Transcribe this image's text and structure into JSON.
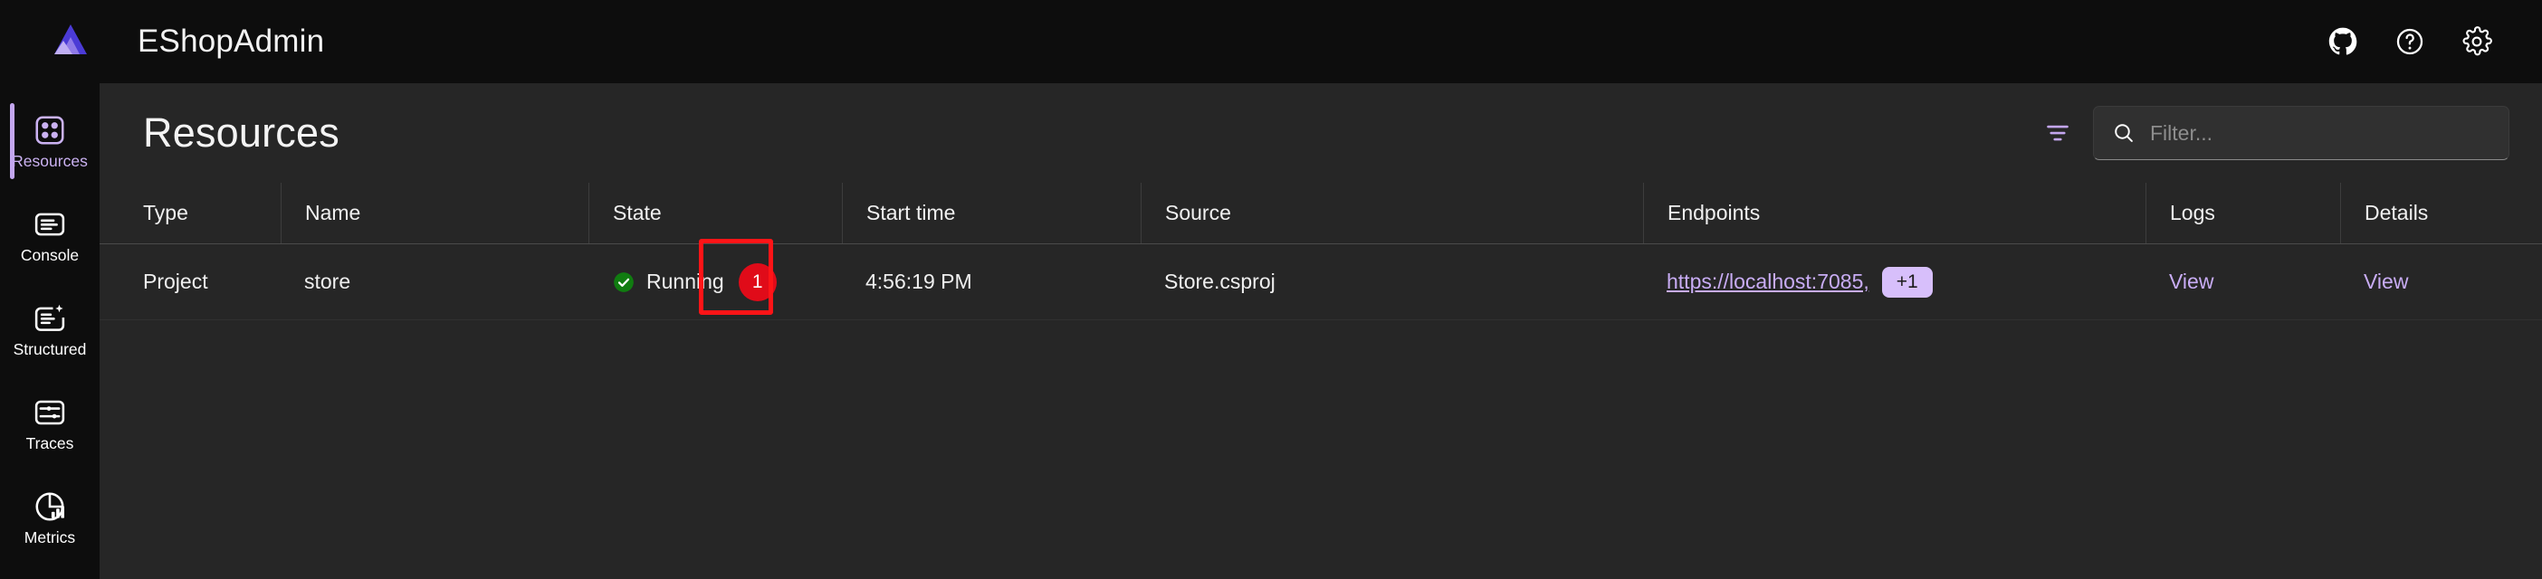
{
  "header": {
    "logo_name": "aspire-logo",
    "title": "EShopAdmin",
    "actions": [
      {
        "name": "github-icon",
        "label": "GitHub"
      },
      {
        "name": "help-icon",
        "label": "Help"
      },
      {
        "name": "settings-gear-icon",
        "label": "Settings"
      }
    ]
  },
  "sidebar": {
    "items": [
      {
        "label": "Resources",
        "icon": "resources-icon",
        "active": true
      },
      {
        "label": "Console",
        "icon": "console-icon",
        "active": false
      },
      {
        "label": "Structured",
        "icon": "structured-icon",
        "active": false
      },
      {
        "label": "Traces",
        "icon": "traces-icon",
        "active": false
      },
      {
        "label": "Metrics",
        "icon": "metrics-icon",
        "active": false
      }
    ]
  },
  "main": {
    "page_title": "Resources",
    "filter_toggle_icon": "filter-icon",
    "search": {
      "icon": "search-icon",
      "placeholder": "Filter...",
      "value": ""
    },
    "table": {
      "columns": [
        "Type",
        "Name",
        "State",
        "Start time",
        "Source",
        "Endpoints",
        "Logs",
        "Details"
      ],
      "rows": [
        {
          "type": "Project",
          "name": "store",
          "state": {
            "icon": "running-check-icon",
            "text": "Running",
            "badge_count": "1",
            "badge_color": "#e00b19",
            "annotated": true
          },
          "start_time": "4:56:19 PM",
          "source": "Store.csproj",
          "endpoints": {
            "url": "https://localhost:7085,",
            "more_label": "+1"
          },
          "logs_label": "View",
          "details_label": "View"
        }
      ]
    }
  },
  "colors": {
    "accent_purple": "#c3a6ef",
    "link_purple": "#c8acf4",
    "badge_purple": "#d7bffb",
    "running_green": "#107c10",
    "annotation_red": "#ff1417",
    "header_bg": "#0d0d0d",
    "main_bg": "#262626"
  }
}
